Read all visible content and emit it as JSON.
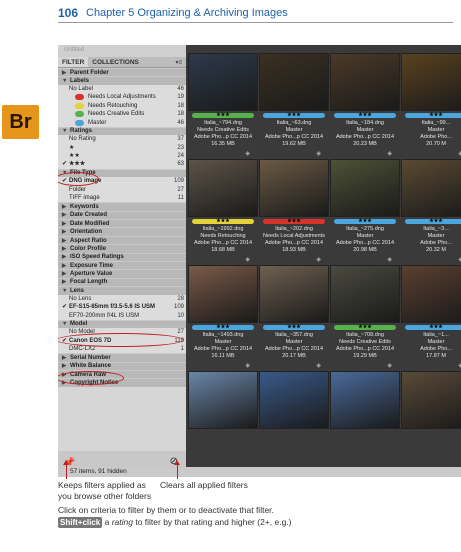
{
  "header": {
    "page_number": "106",
    "chapter": "Chapter 5   Organizing & Archiving Images"
  },
  "logo": {
    "text": "Br",
    "color": "#e6951b"
  },
  "panel": {
    "top_label": "Untitled",
    "tabs": [
      "FILTER",
      "COLLECTIONS"
    ],
    "menu_icon": "panel-menu-icon"
  },
  "filters": [
    {
      "type": "header",
      "label": "Parent Folder",
      "open": false
    },
    {
      "type": "header",
      "label": "Labels",
      "open": true
    },
    {
      "type": "item",
      "label": "No Label",
      "count": "46"
    },
    {
      "type": "item",
      "label": "Needs Local Adjustments",
      "count": "19",
      "swatch": "#d8332b"
    },
    {
      "type": "item",
      "label": "Needs Retouching",
      "count": "18",
      "swatch": "#e2d437"
    },
    {
      "type": "item",
      "label": "Needs Creative Edits",
      "count": "18",
      "swatch": "#56b24a"
    },
    {
      "type": "item",
      "label": "Master",
      "count": "46",
      "swatch": "#4aa6dc"
    },
    {
      "type": "header",
      "label": "Ratings",
      "open": true
    },
    {
      "type": "item",
      "label": "No Rating",
      "count": "37"
    },
    {
      "type": "item",
      "label": "★",
      "count": "23"
    },
    {
      "type": "item",
      "label": "★★",
      "count": "24"
    },
    {
      "type": "item",
      "label": "★★★",
      "count": "63",
      "checked": true
    },
    {
      "type": "header",
      "label": "File Type",
      "open": true
    },
    {
      "type": "item",
      "label": "DNG image",
      "count": "109",
      "checked": true
    },
    {
      "type": "item",
      "label": "Folder",
      "count": "27"
    },
    {
      "type": "item",
      "label": "TIFF image",
      "count": "11"
    },
    {
      "type": "header",
      "label": "Keywords",
      "open": false
    },
    {
      "type": "header",
      "label": "Date Created",
      "open": false
    },
    {
      "type": "header",
      "label": "Date Modified",
      "open": false
    },
    {
      "type": "header",
      "label": "Orientation",
      "open": false
    },
    {
      "type": "header",
      "label": "Aspect Ratio",
      "open": false
    },
    {
      "type": "header",
      "label": "Color Profile",
      "open": false
    },
    {
      "type": "header",
      "label": "ISO Speed Ratings",
      "open": false
    },
    {
      "type": "header",
      "label": "Exposure Time",
      "open": false
    },
    {
      "type": "header",
      "label": "Aperture Value",
      "open": false
    },
    {
      "type": "header",
      "label": "Focal Length",
      "open": false
    },
    {
      "type": "header",
      "label": "Lens",
      "open": true
    },
    {
      "type": "item",
      "label": "No Lens",
      "count": "28"
    },
    {
      "type": "item",
      "label": "EF-S15-85mm f/3.5-5.6 IS USM",
      "count": "109",
      "checked": true
    },
    {
      "type": "item",
      "label": "EF70-200mm f/4L IS USM",
      "count": "10"
    },
    {
      "type": "header",
      "label": "Model",
      "open": true
    },
    {
      "type": "item",
      "label": "No Model",
      "count": "27"
    },
    {
      "type": "item",
      "label": "Canon EOS 7D",
      "count": "119",
      "checked": true
    },
    {
      "type": "item",
      "label": "DMC-LX2",
      "count": "1"
    },
    {
      "type": "header",
      "label": "Serial Number",
      "open": false
    },
    {
      "type": "header",
      "label": "White Balance",
      "open": false
    },
    {
      "type": "header",
      "label": "Camera Raw",
      "open": false
    },
    {
      "type": "header",
      "label": "Copyright Notice",
      "open": false
    }
  ],
  "status": {
    "text": "57 items, 91 hidden"
  },
  "thumbnails": [
    {
      "stars": "★★★",
      "bar": "#56b24a",
      "name": "Italia_~794.dng",
      "label": "Needs Creative Edits",
      "app": "Adobe Pho...p CC 2014",
      "size": "16.35 MB",
      "bg": "#2d3a4a"
    },
    {
      "stars": "★★★",
      "bar": "#4aa6dc",
      "name": "Italia_~63.dng",
      "label": "Master",
      "app": "Adobe Pho...p CC 2014",
      "size": "19.62 MB",
      "bg": "#3a3022"
    },
    {
      "stars": "★★★",
      "bar": "#4aa6dc",
      "name": "Italia_~184.dng",
      "label": "Master",
      "app": "Adobe Pho...p CC 2014",
      "size": "20.23 MB",
      "bg": "#4a3a28"
    },
    {
      "stars": "★★★",
      "bar": "#4aa6dc",
      "name": "Italia_~99...",
      "label": "Master",
      "app": "Adobe Pho...",
      "size": "20.70 M",
      "bg": "#5a4220"
    },
    {
      "stars": "★★★",
      "bar": "#e2d437",
      "name": "Italia_~1992.dng",
      "label": "Needs Retouching",
      "app": "Adobe Pho...p CC 2014",
      "size": "18.68 MB",
      "bg": "#5e5448"
    },
    {
      "stars": "★★★",
      "bar": "#d8332b",
      "name": "Italia_~202.dng",
      "label": "Needs Local Adjustments",
      "app": "Adobe Pho...p CC 2014",
      "size": "18.93 MB",
      "bg": "#6a5a44"
    },
    {
      "stars": "★★★",
      "bar": "#4aa6dc",
      "name": "Italia_~275.dng",
      "label": "Master",
      "app": "Adobe Pho...p CC 2014",
      "size": "20.98 MB",
      "bg": "#4c5236"
    },
    {
      "stars": "★★★",
      "bar": "#4aa6dc",
      "name": "Italia_~3...",
      "label": "Master",
      "app": "Adobe Pho...",
      "size": "20.32 M",
      "bg": "#5a4a32"
    },
    {
      "stars": "★★★",
      "bar": "#4aa6dc",
      "name": "Italia_~1493.dng",
      "label": "Master",
      "app": "Adobe Pho...p CC 2014",
      "size": "16.11 MB",
      "bg": "#7a5a48"
    },
    {
      "stars": "★★★",
      "bar": "#4aa6dc",
      "name": "Italia_~357.dng",
      "label": "Master",
      "app": "Adobe Pho...p CC 2014",
      "size": "20.17 MB",
      "bg": "#6e6050"
    },
    {
      "stars": "★★★",
      "bar": "#56b24a",
      "name": "Italia_~708.dng",
      "label": "Needs Creative Edits",
      "app": "Adobe Pho...p CC 2014",
      "size": "19.29 MB",
      "bg": "#4a4a40"
    },
    {
      "stars": "★★★",
      "bar": "#4aa6dc",
      "name": "Italia_~1...",
      "label": "Master",
      "app": "Adobe Pho...",
      "size": "17.87 M",
      "bg": "#5a4030"
    },
    {
      "stars": "",
      "bar": "",
      "name": "",
      "label": "",
      "app": "",
      "size": "",
      "bg": "#6a86a8"
    },
    {
      "stars": "",
      "bar": "",
      "name": "",
      "label": "",
      "app": "",
      "size": "",
      "bg": "#3a5a8a"
    },
    {
      "stars": "",
      "bar": "",
      "name": "",
      "label": "",
      "app": "",
      "size": "",
      "bg": "#4a6a9a"
    },
    {
      "stars": "",
      "bar": "",
      "name": "",
      "label": "",
      "app": "",
      "size": "",
      "bg": "#5a4a38"
    }
  ],
  "captions": {
    "pin": "Keeps filters applied as you browse other folders",
    "clear": "Clears all applied filters"
  },
  "body": {
    "line1": "Click on criteria to filter by them or to deactivate that filter.",
    "kbd": "Shift+click",
    "line2_pre": " a ",
    "line2_em": "rating",
    "line2_post": " to filter by that rating and higher (2+, e.g.)"
  }
}
